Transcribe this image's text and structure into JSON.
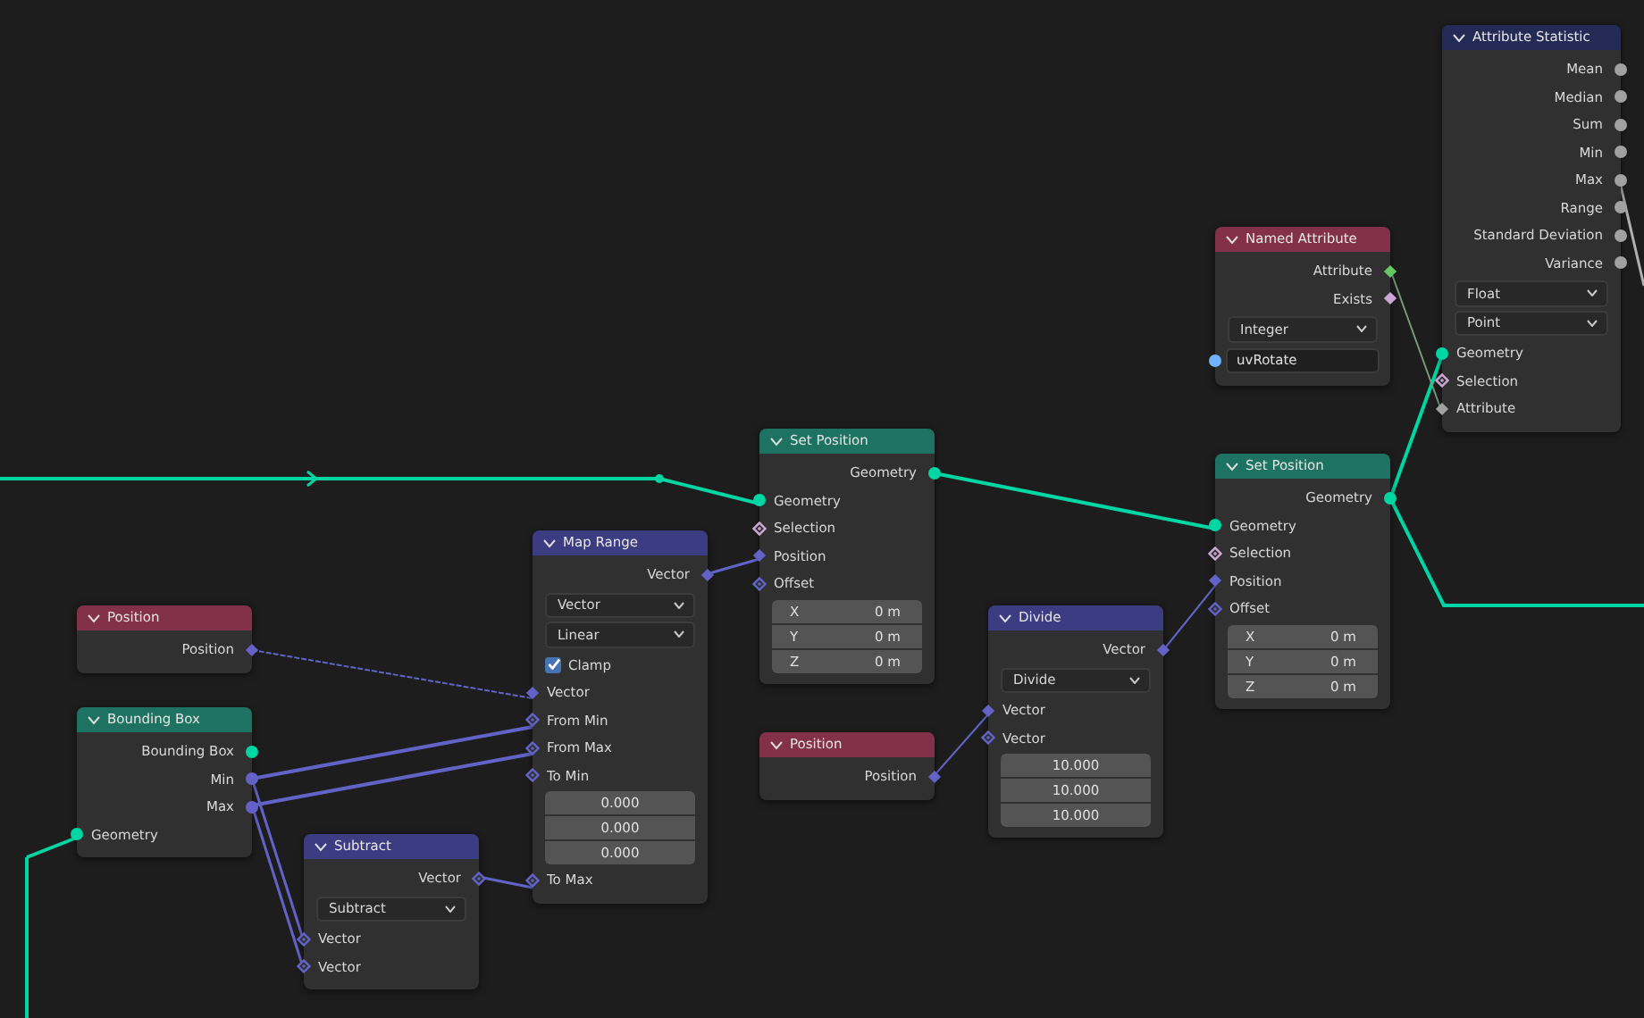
{
  "nodes": [
    {
      "title": "Attribute Statistic",
      "color": "#242a56",
      "rows": [
        {
          "kind": "output",
          "label": "Mean",
          "socket": {
            "kind": "circle",
            "color": "#a1a1a1"
          }
        },
        {
          "kind": "output",
          "label": "Median",
          "socket": {
            "kind": "circle",
            "color": "#a1a1a1"
          }
        },
        {
          "kind": "output",
          "label": "Sum",
          "socket": {
            "kind": "circle",
            "color": "#a1a1a1"
          }
        },
        {
          "kind": "output",
          "label": "Min",
          "socket": {
            "kind": "circle",
            "color": "#a1a1a1"
          }
        },
        {
          "kind": "output",
          "label": "Max",
          "socket": {
            "kind": "circle",
            "color": "#a1a1a1"
          }
        },
        {
          "kind": "output",
          "label": "Range",
          "socket": {
            "kind": "circle",
            "color": "#a1a1a1"
          }
        },
        {
          "kind": "output",
          "label": "Standard Deviation",
          "socket": {
            "kind": "circle",
            "color": "#a1a1a1"
          }
        },
        {
          "kind": "output",
          "label": "Variance",
          "socket": {
            "kind": "circle",
            "color": "#a1a1a1"
          }
        },
        {
          "kind": "dropdown",
          "value": "Float"
        },
        {
          "kind": "dropdown",
          "value": "Point"
        },
        {
          "kind": "input",
          "label": "Geometry",
          "socket": {
            "kind": "circle",
            "color": "#00d6a3"
          }
        },
        {
          "kind": "input",
          "label": "Selection",
          "socket": {
            "kind": "hollow",
            "color": "#cca6d6"
          }
        },
        {
          "kind": "input",
          "label": "Attribute",
          "socket": {
            "kind": "diamond",
            "color": "#a1a1a1"
          }
        }
      ]
    },
    {
      "title": "Named Attribute",
      "color": "#83314a",
      "rows": [
        {
          "kind": "output",
          "label": "Attribute",
          "socket": {
            "kind": "diamond",
            "color": "#63c763"
          }
        },
        {
          "kind": "output",
          "label": "Exists",
          "socket": {
            "kind": "diamond",
            "color": "#cca6d6"
          }
        },
        {
          "kind": "dropdown",
          "value": "Integer"
        },
        {
          "kind": "field",
          "value": "uvRotate",
          "socket": {
            "kind": "circle",
            "color": "#70b2ff"
          }
        }
      ]
    },
    {
      "title": "Set Position",
      "color": "#1d7262",
      "rows": [
        {
          "kind": "output",
          "label": "Geometry",
          "socket": {
            "kind": "circle",
            "color": "#00d6a3"
          }
        },
        {
          "kind": "input",
          "label": "Geometry",
          "socket": {
            "kind": "circle",
            "color": "#00d6a3"
          }
        },
        {
          "kind": "input",
          "label": "Selection",
          "socket": {
            "kind": "hollow",
            "color": "#cca6d6"
          }
        },
        {
          "kind": "input",
          "label": "Position",
          "socket": {
            "kind": "diamond",
            "color": "#6363c7"
          }
        },
        {
          "kind": "input",
          "label": "Offset",
          "socket": {
            "kind": "hollow",
            "color": "#6363c7"
          }
        },
        {
          "kind": "values",
          "items": [
            {
              "label": "X",
              "value": "0 m"
            },
            {
              "label": "Y",
              "value": "0 m"
            },
            {
              "label": "Z",
              "value": "0 m"
            }
          ]
        }
      ]
    },
    {
      "title": "Set Position",
      "color": "#1d7262",
      "rows": [
        {
          "kind": "output",
          "label": "Geometry",
          "socket": {
            "kind": "circle",
            "color": "#00d6a3"
          }
        },
        {
          "kind": "input",
          "label": "Geometry",
          "socket": {
            "kind": "circle",
            "color": "#00d6a3"
          }
        },
        {
          "kind": "input",
          "label": "Selection",
          "socket": {
            "kind": "hollow",
            "color": "#cca6d6"
          }
        },
        {
          "kind": "input",
          "label": "Position",
          "socket": {
            "kind": "diamond",
            "color": "#6363c7"
          }
        },
        {
          "kind": "input",
          "label": "Offset",
          "socket": {
            "kind": "hollow",
            "color": "#6363c7"
          }
        },
        {
          "kind": "values",
          "items": [
            {
              "label": "X",
              "value": "0 m"
            },
            {
              "label": "Y",
              "value": "0 m"
            },
            {
              "label": "Z",
              "value": "0 m"
            }
          ]
        }
      ]
    },
    {
      "title": "Map Range",
      "color": "#3c3c83",
      "rows": [
        {
          "kind": "output",
          "label": "Vector",
          "socket": {
            "kind": "diamond",
            "color": "#6363c7"
          }
        },
        {
          "kind": "dropdown",
          "value": "Vector"
        },
        {
          "kind": "dropdown",
          "value": "Linear"
        },
        {
          "kind": "checkbox",
          "label": "Clamp",
          "checked": true
        },
        {
          "kind": "input",
          "label": "Vector",
          "socket": {
            "kind": "diamond",
            "color": "#6363c7"
          }
        },
        {
          "kind": "input",
          "label": "From Min",
          "socket": {
            "kind": "hollow",
            "color": "#6363c7"
          }
        },
        {
          "kind": "input",
          "label": "From Max",
          "socket": {
            "kind": "hollow",
            "color": "#6363c7"
          }
        },
        {
          "kind": "input",
          "label": "To Min",
          "socket": {
            "kind": "hollow",
            "color": "#6363c7"
          }
        },
        {
          "kind": "values",
          "items": [
            {
              "value": "0.000"
            },
            {
              "value": "0.000"
            },
            {
              "value": "0.000"
            }
          ]
        },
        {
          "kind": "input",
          "label": "To Max",
          "socket": {
            "kind": "hollow",
            "color": "#6363c7"
          }
        }
      ]
    },
    {
      "title": "Divide",
      "color": "#3c3c83",
      "rows": [
        {
          "kind": "output",
          "label": "Vector",
          "socket": {
            "kind": "diamond",
            "color": "#6363c7"
          }
        },
        {
          "kind": "dropdown",
          "value": "Divide"
        },
        {
          "kind": "input",
          "label": "Vector",
          "socket": {
            "kind": "diamond",
            "color": "#6363c7"
          }
        },
        {
          "kind": "input",
          "label": "Vector",
          "socket": {
            "kind": "hollow",
            "color": "#6363c7"
          }
        },
        {
          "kind": "values",
          "items": [
            {
              "value": "10.000"
            },
            {
              "value": "10.000"
            },
            {
              "value": "10.000"
            }
          ]
        }
      ]
    },
    {
      "title": "Position",
      "color": "#83314a",
      "rows": [
        {
          "kind": "output",
          "label": "Position",
          "socket": {
            "kind": "diamond",
            "color": "#6363c7"
          }
        }
      ]
    },
    {
      "title": "Position",
      "color": "#83314a",
      "rows": [
        {
          "kind": "output",
          "label": "Position",
          "socket": {
            "kind": "diamond",
            "color": "#6363c7"
          }
        }
      ]
    },
    {
      "title": "Bounding Box",
      "color": "#1d7262",
      "rows": [
        {
          "kind": "output",
          "label": "Bounding Box",
          "socket": {
            "kind": "circle",
            "color": "#00d6a3"
          }
        },
        {
          "kind": "output",
          "label": "Min",
          "socket": {
            "kind": "circle",
            "color": "#6363c7"
          }
        },
        {
          "kind": "output",
          "label": "Max",
          "socket": {
            "kind": "circle",
            "color": "#6363c7"
          }
        },
        {
          "kind": "input",
          "label": "Geometry",
          "socket": {
            "kind": "circle",
            "color": "#00d6a3"
          }
        }
      ]
    },
    {
      "title": "Subtract",
      "color": "#3c3c83",
      "rows": [
        {
          "kind": "output",
          "label": "Vector",
          "socket": {
            "kind": "hollow",
            "color": "#6363c7"
          }
        },
        {
          "kind": "dropdown",
          "value": "Subtract"
        },
        {
          "kind": "input",
          "label": "Vector",
          "socket": {
            "kind": "hollow",
            "color": "#6363c7"
          }
        },
        {
          "kind": "input",
          "label": "Vector",
          "socket": {
            "kind": "hollow",
            "color": "#6363c7"
          }
        }
      ]
    }
  ]
}
